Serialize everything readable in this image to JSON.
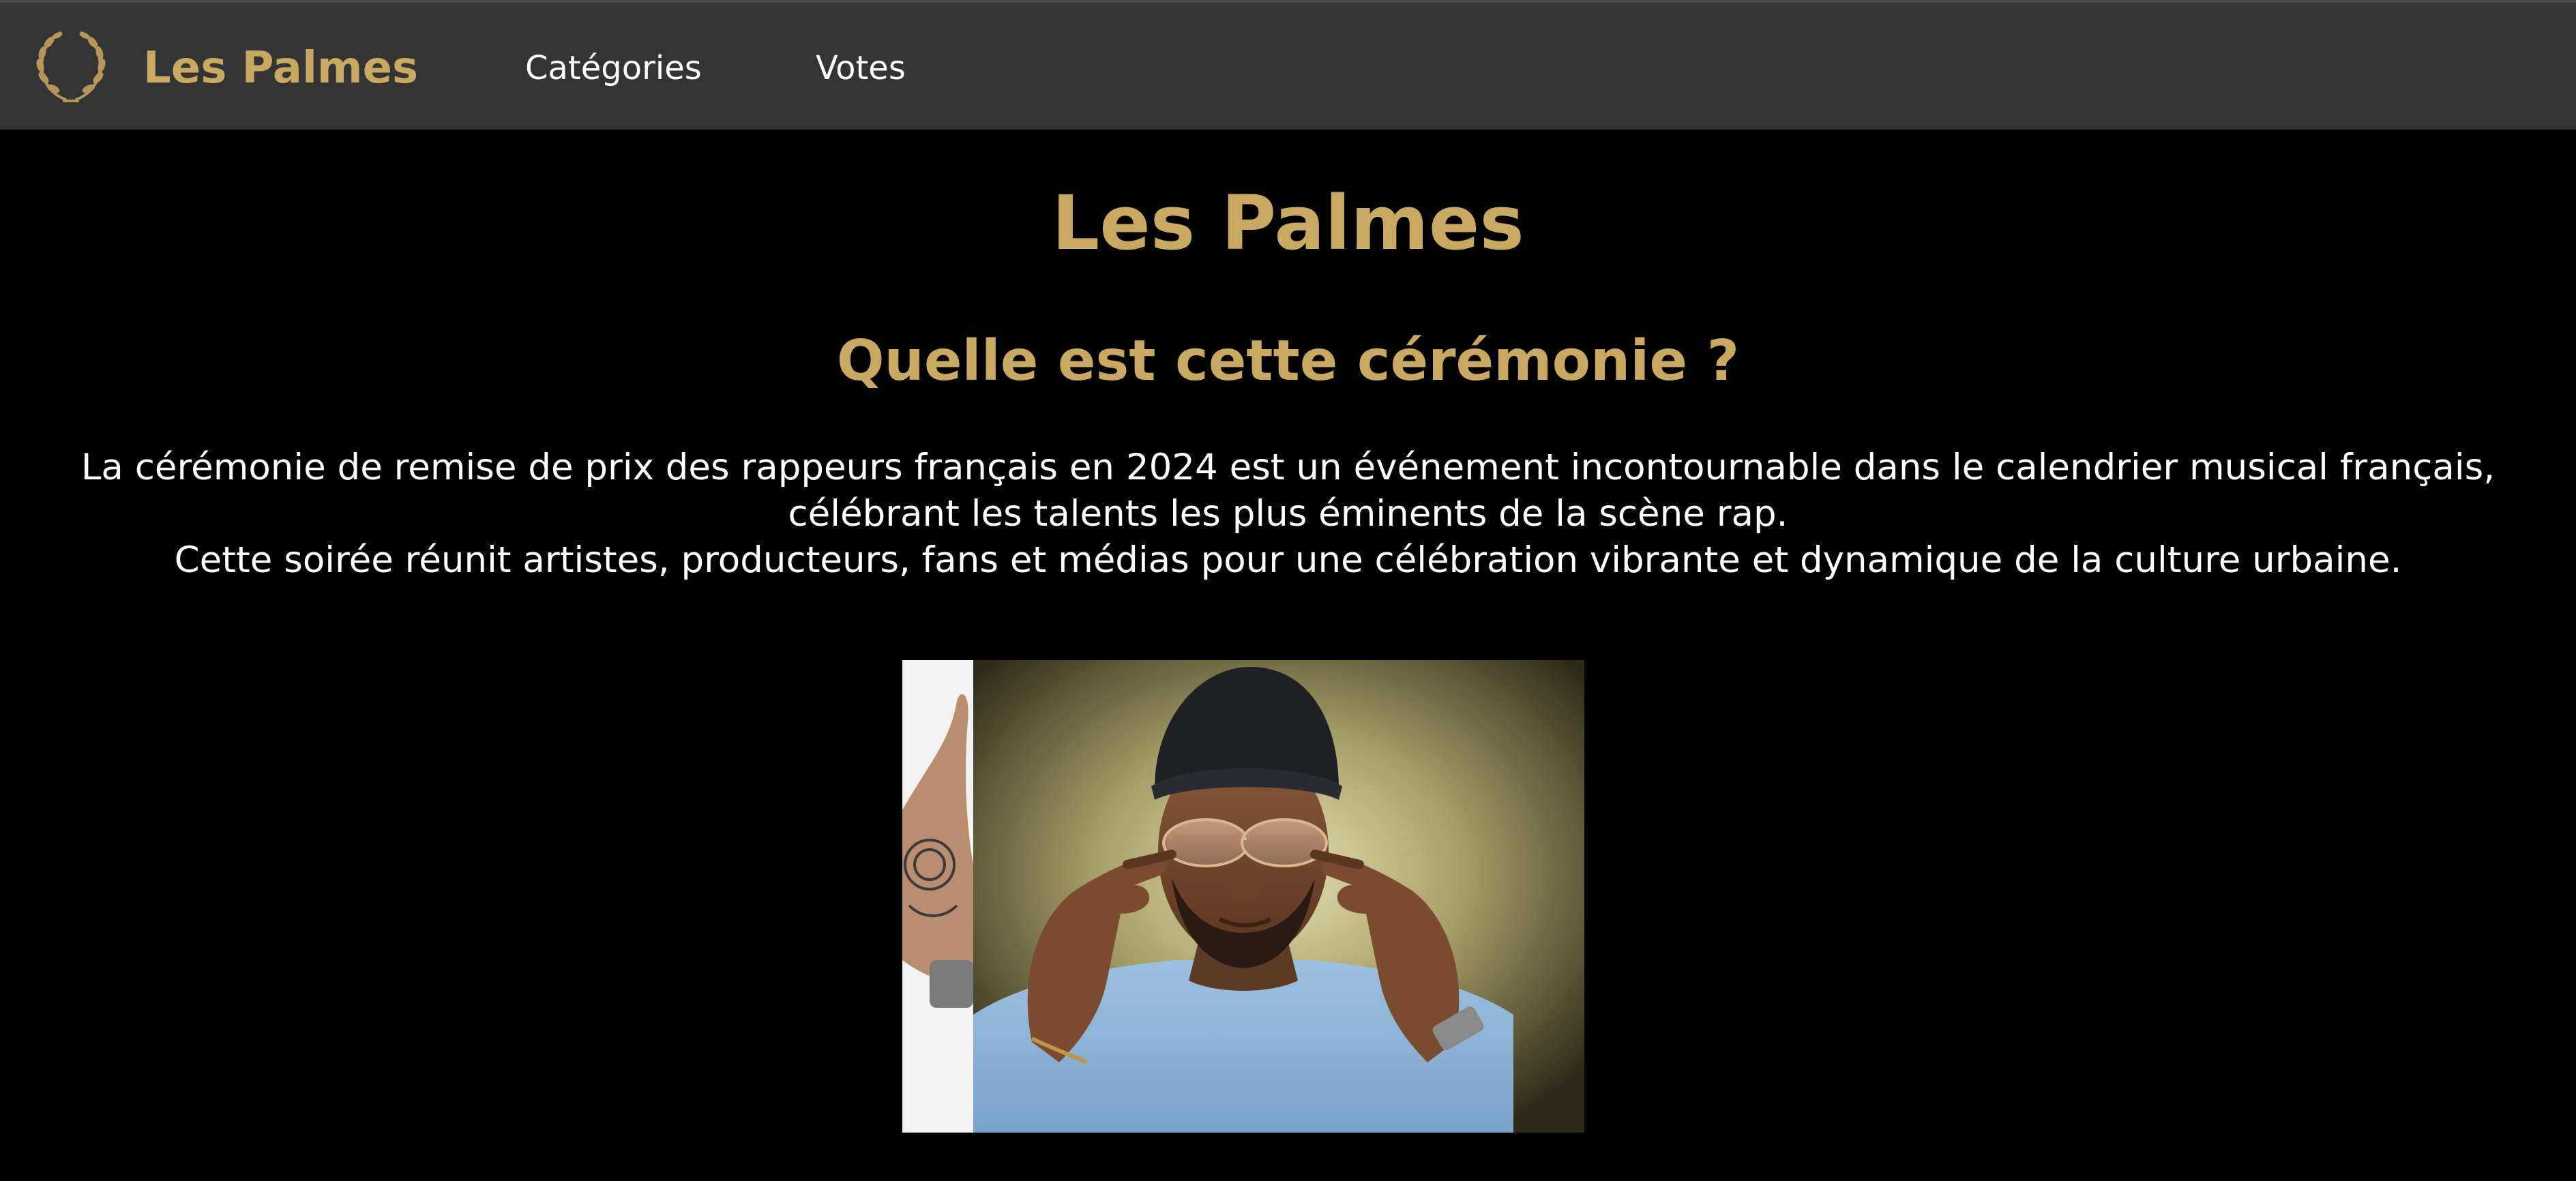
{
  "nav": {
    "logo_icon": "laurel-wreath-icon",
    "brand": "Les Palmes",
    "links": [
      {
        "label": "Catégories"
      },
      {
        "label": "Votes"
      }
    ]
  },
  "main": {
    "title": "Les Palmes",
    "section_title": "Quelle est cette cérémonie ?",
    "paragraph_1": "La cérémonie de remise de prix des rappeurs français en 2024 est un événement incontournable dans le calendrier musical français, célébrant les talents les plus éminents de la scène rap.",
    "paragraph_2": "Cette soirée réunit artistes, producteurs, fans et médias pour une célébration vibrante et dynamique de la culture urbaine."
  },
  "carousel": {
    "image": "rapper-portrait-photo"
  },
  "colors": {
    "navbar_bg": "#343434",
    "page_bg": "#000000",
    "accent_gold": "#c9a961",
    "text": "#ffffff"
  }
}
